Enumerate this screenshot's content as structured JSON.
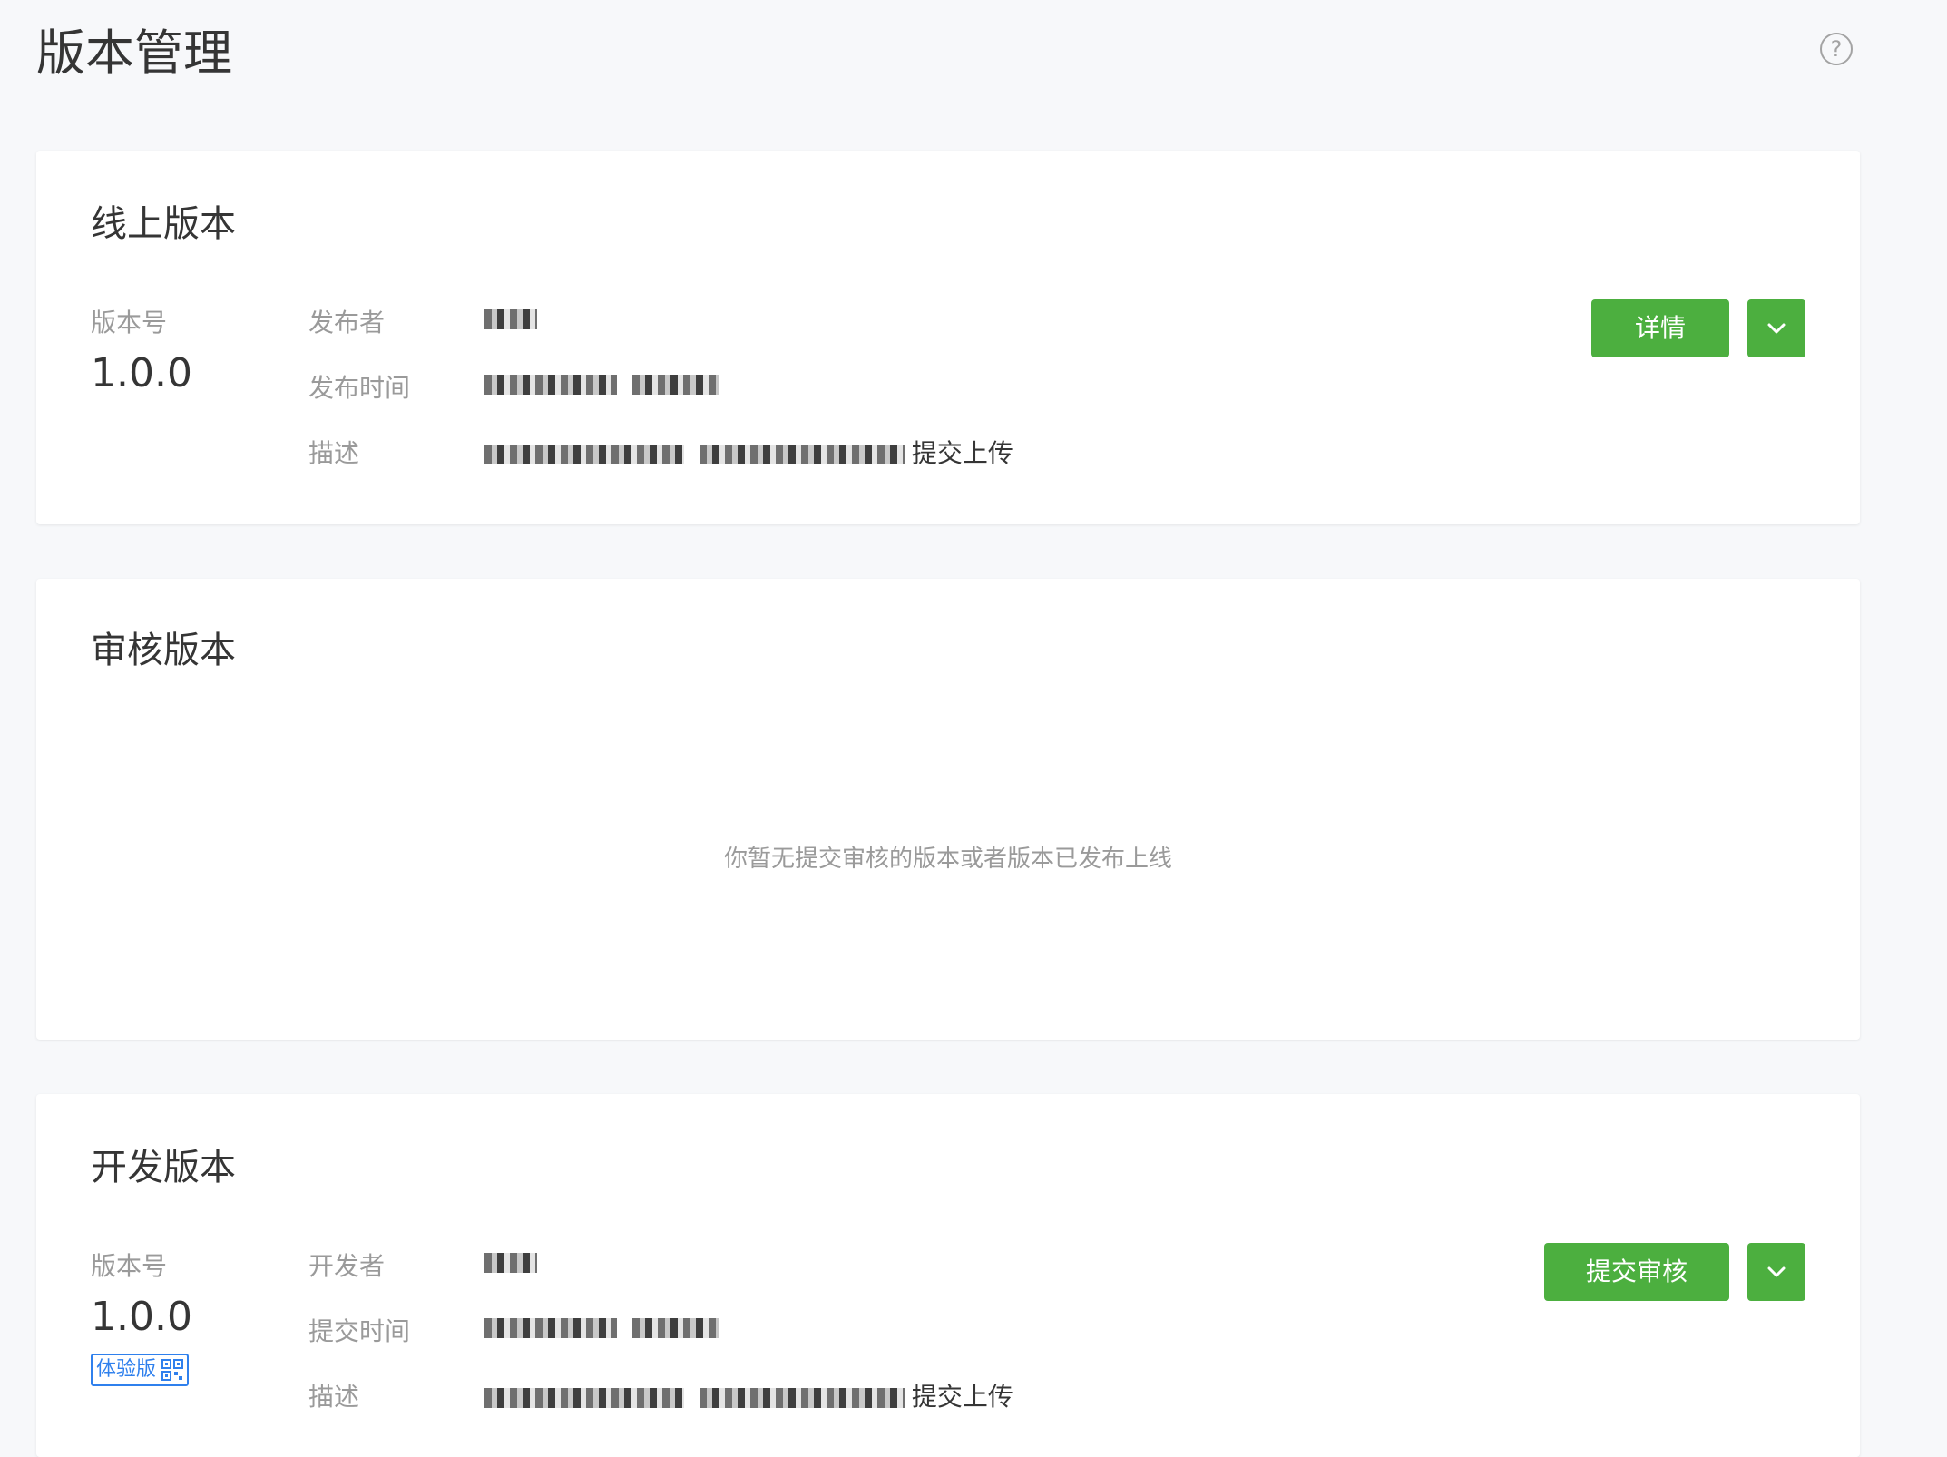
{
  "page": {
    "title": "版本管理",
    "help_icon": "question-circle-icon"
  },
  "online": {
    "title": "线上版本",
    "version_label": "版本号",
    "version": "1.0.0",
    "publisher_label": "发布者",
    "publish_time_label": "发布时间",
    "description_label": "描述",
    "description_suffix": "提交上传",
    "details_button": "详情",
    "dropdown_icon": "chevron-down-icon"
  },
  "review": {
    "title": "审核版本",
    "empty_text": "你暂无提交审核的版本或者版本已发布上线"
  },
  "dev": {
    "title": "开发版本",
    "version_label": "版本号",
    "version": "1.0.0",
    "experience_badge": "体验版",
    "developer_label": "开发者",
    "submit_time_label": "提交时间",
    "description_label": "描述",
    "description_suffix": "提交上传",
    "submit_button": "提交审核",
    "dropdown_icon": "chevron-down-icon",
    "qr_icon": "qr-code-icon"
  },
  "colors": {
    "primary_green": "#4caf3f",
    "badge_blue": "#2f80ed",
    "background": "#f7f8fa"
  }
}
